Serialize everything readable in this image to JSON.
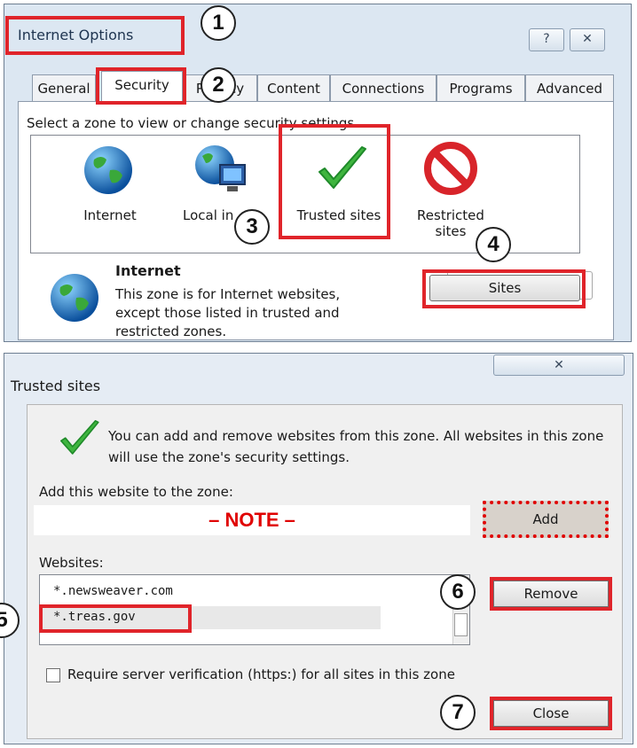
{
  "internet_options": {
    "title": "Internet Options",
    "help_glyph": "?",
    "close_glyph": "✕",
    "tabs": [
      "General",
      "Security",
      "Privacy",
      "Content",
      "Connections",
      "Programs",
      "Advanced"
    ],
    "active_tab": "Security",
    "zone_prompt": "Select a zone to view or change security settings.",
    "zones": [
      {
        "label": "Internet",
        "icon": "globe-icon"
      },
      {
        "label": "Local in",
        "icon": "local-intranet-icon"
      },
      {
        "label": "Trusted sites",
        "icon": "checkmark-icon"
      },
      {
        "label": "Restricted sites",
        "icon": "no-entry-icon"
      }
    ],
    "selected_zone": {
      "name": "Internet",
      "description": "This zone is for Internet websites, except those listed in trusted and restricted zones."
    },
    "sites_button": "Sites"
  },
  "trusted_sites": {
    "title": "Trusted sites",
    "close_glyph": "✕",
    "intro": "You can add and remove websites from this zone. All websites in this zone will use the zone's security settings.",
    "add_label": "Add this website to the zone:",
    "add_input_value": "– NOTE –",
    "add_button": "Add",
    "websites_label": "Websites:",
    "websites": [
      "*.newsweaver.com",
      "*.treas.gov"
    ],
    "remove_button": "Remove",
    "verify_label": "Require server verification (https:) for all sites in this zone",
    "verify_checked": false,
    "close_button": "Close"
  },
  "annotations": {
    "steps": [
      "1",
      "2",
      "3",
      "4",
      "5",
      "6",
      "7"
    ],
    "highlight_color": "#e0242a",
    "note_color": "#e00000"
  }
}
